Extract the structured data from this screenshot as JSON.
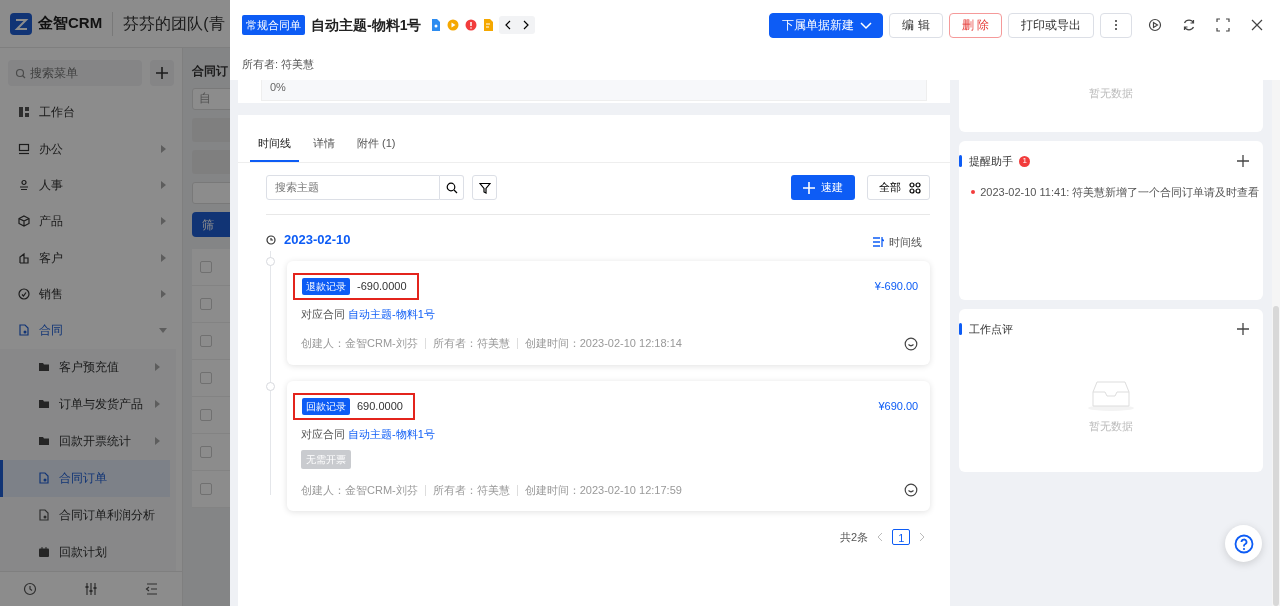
{
  "app": {
    "brand": "金智CRM",
    "team": "芬芬的团队(青",
    "search": {
      "placeholder": "搜索菜单"
    }
  },
  "menu": [
    {
      "label": "工作台",
      "expandable": false,
      "expanded": false,
      "selected": false
    },
    {
      "label": "办公",
      "expandable": true,
      "expanded": false,
      "selected": false
    },
    {
      "label": "人事",
      "expandable": true,
      "expanded": false,
      "selected": false
    },
    {
      "label": "产品",
      "expandable": true,
      "expanded": false,
      "selected": false
    },
    {
      "label": "客户",
      "expandable": true,
      "expanded": false,
      "selected": false
    },
    {
      "label": "销售",
      "expandable": true,
      "expanded": false,
      "selected": false
    },
    {
      "label": "合同",
      "expandable": true,
      "expanded": true,
      "selected": false,
      "children": [
        {
          "label": "客户预充值",
          "expandable": true,
          "selected": false
        },
        {
          "label": "订单与发货产品",
          "expandable": true,
          "selected": false
        },
        {
          "label": "回款开票统计",
          "expandable": true,
          "selected": false
        },
        {
          "label": "合同订单",
          "expandable": false,
          "selected": true
        },
        {
          "label": "合同订单利润分析",
          "expandable": false,
          "selected": false
        },
        {
          "label": "回款计划",
          "expandable": false,
          "selected": false
        }
      ]
    }
  ],
  "list_page": {
    "title": "合同订",
    "field_value": "自",
    "filter_button": "筛",
    "checkboxes": [
      {
        "checked": false
      },
      {
        "checked": false
      },
      {
        "checked": false
      },
      {
        "checked": false
      },
      {
        "checked": false
      },
      {
        "checked": false
      },
      {
        "checked": false
      }
    ]
  },
  "drawer": {
    "type_tag": "常规合同单",
    "title": "自动主题-物料1号",
    "owner": "所有者: 符美慧",
    "buttons": [
      {
        "label": "下属单据新建",
        "kind": "primary"
      },
      {
        "label": "编 辑",
        "kind": "default"
      },
      {
        "label": "删 除",
        "kind": "danger"
      },
      {
        "label": "打印或导出",
        "kind": "default"
      }
    ]
  },
  "progress_text": "0%",
  "tabs": [
    {
      "label": "时间线",
      "selected": true
    },
    {
      "label": "详情",
      "selected": false
    },
    {
      "label": "附件 (1)",
      "selected": false
    }
  ],
  "toolbar": {
    "search": {
      "placeholder": "搜索主题"
    },
    "quick_create": "速建",
    "scope": "全部"
  },
  "timeline": {
    "date": "2023-02-10",
    "view_label": "时间线",
    "records": [
      {
        "tag": "退款记录",
        "amount": "-690.0000",
        "total": "¥-690.00",
        "highlighted": true,
        "contract_label": "对应合同",
        "contract_link": "自动主题-物料1号",
        "meta": [
          "创建人：金智CRM-刘芬",
          "所有者：符美慧",
          "创建时间：2023-02-10 12:18:14"
        ]
      },
      {
        "tag": "回款记录",
        "amount": "690.0000",
        "total": "¥690.00",
        "highlighted": true,
        "contract_label": "对应合同",
        "contract_link": "自动主题-物料1号",
        "invoice_tag": "无需开票",
        "meta": [
          "创建人：金智CRM-刘芬",
          "所有者：符美慧",
          "创建时间：2023-02-10 12:17:59"
        ]
      }
    ]
  },
  "pagination": {
    "total": "共2条",
    "pages": [
      {
        "label": "1",
        "selected": true
      }
    ]
  },
  "side": {
    "top_empty": "暂无数据",
    "reminder": {
      "title": "提醒助手",
      "badge": "1",
      "items": [
        "2023-02-10 11:41: 符美慧新增了一个合同订单请及时查看"
      ]
    },
    "review": {
      "title": "工作点评",
      "empty": "暂无数据"
    }
  }
}
